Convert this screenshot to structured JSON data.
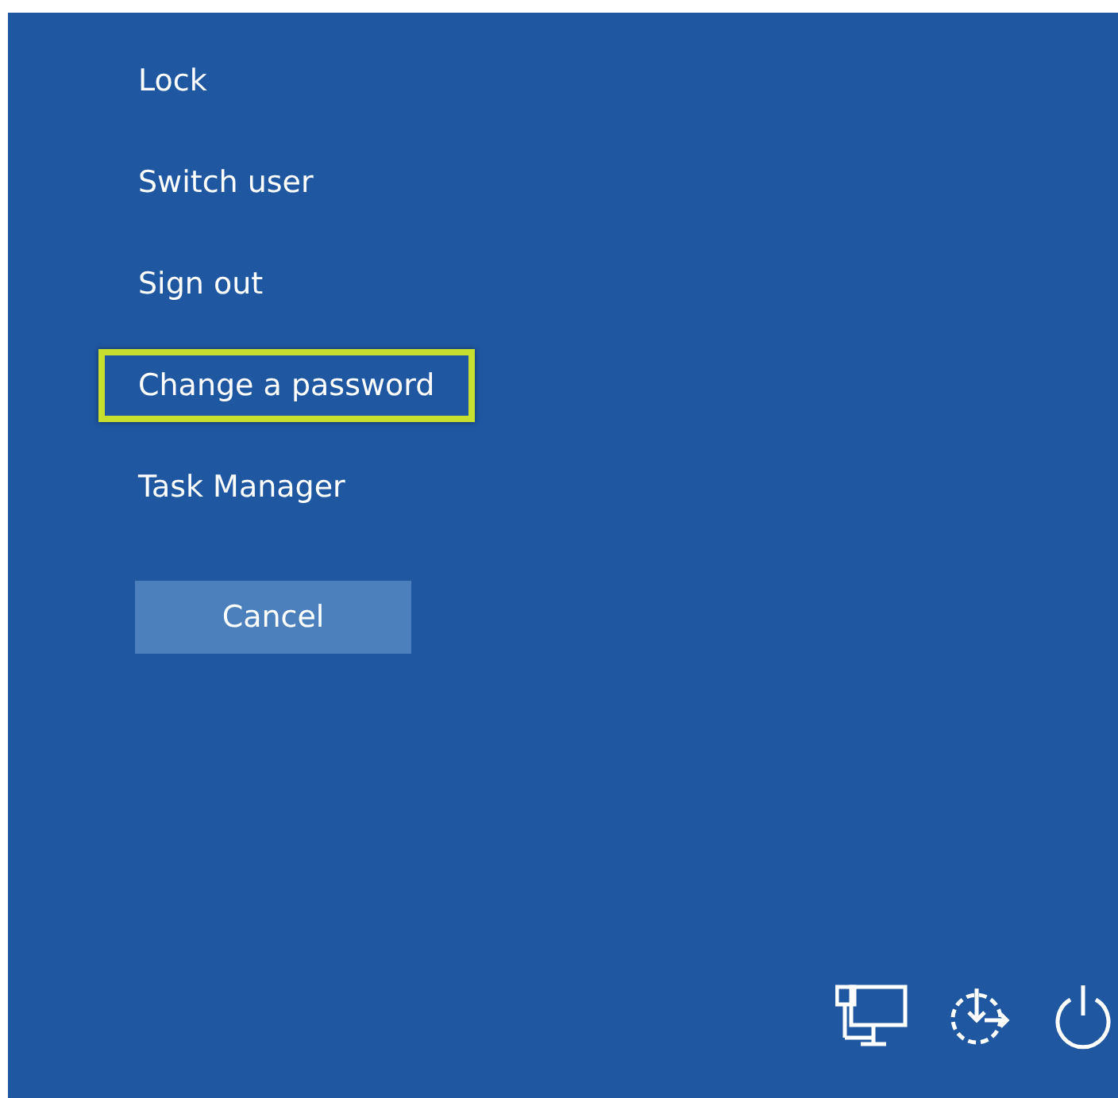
{
  "menu_items": [
    {
      "label": "Lock",
      "selected": false
    },
    {
      "label": "Switch user",
      "selected": false
    },
    {
      "label": "Sign out",
      "selected": false
    },
    {
      "label": "Change a password",
      "selected": true
    },
    {
      "label": "Task Manager",
      "selected": false
    }
  ],
  "cancel_button": {
    "label": "Cancel"
  },
  "tray": [
    {
      "kind": "network"
    },
    {
      "kind": "accessibility"
    },
    {
      "kind": "power"
    }
  ]
}
